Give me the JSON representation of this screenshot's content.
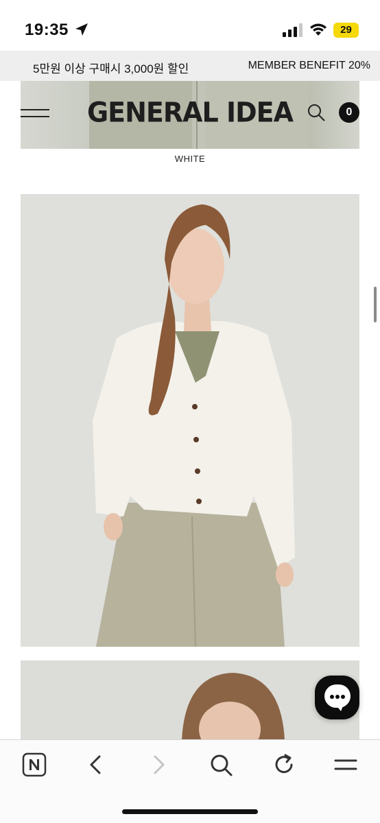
{
  "status_bar": {
    "time": "19:35",
    "battery": "29",
    "icons": [
      "location-arrow-icon",
      "cellular-signal-icon",
      "wifi-icon",
      "battery-charging-icon"
    ]
  },
  "promo": {
    "left_text": "5만원 이상 구매시 3,000원 할인",
    "right_text": "MEMBER BENEFIT 20%"
  },
  "header": {
    "brand": "GENERAL IDEA",
    "cart_count": "0",
    "icons": [
      "menu-icon",
      "search-icon"
    ]
  },
  "product": {
    "color_label": "WHITE"
  },
  "chat": {
    "icon": "chat-bubble-icon"
  },
  "browser_toolbar": {
    "items": [
      "naver-home-icon",
      "back-icon",
      "forward-icon",
      "search-icon",
      "reload-icon",
      "menu-icon"
    ]
  },
  "colors": {
    "promo_bg": "#eeeeee",
    "badge_bg": "#111111",
    "battery": "#f5d90a",
    "photo_bg": "#dfe0dc"
  }
}
